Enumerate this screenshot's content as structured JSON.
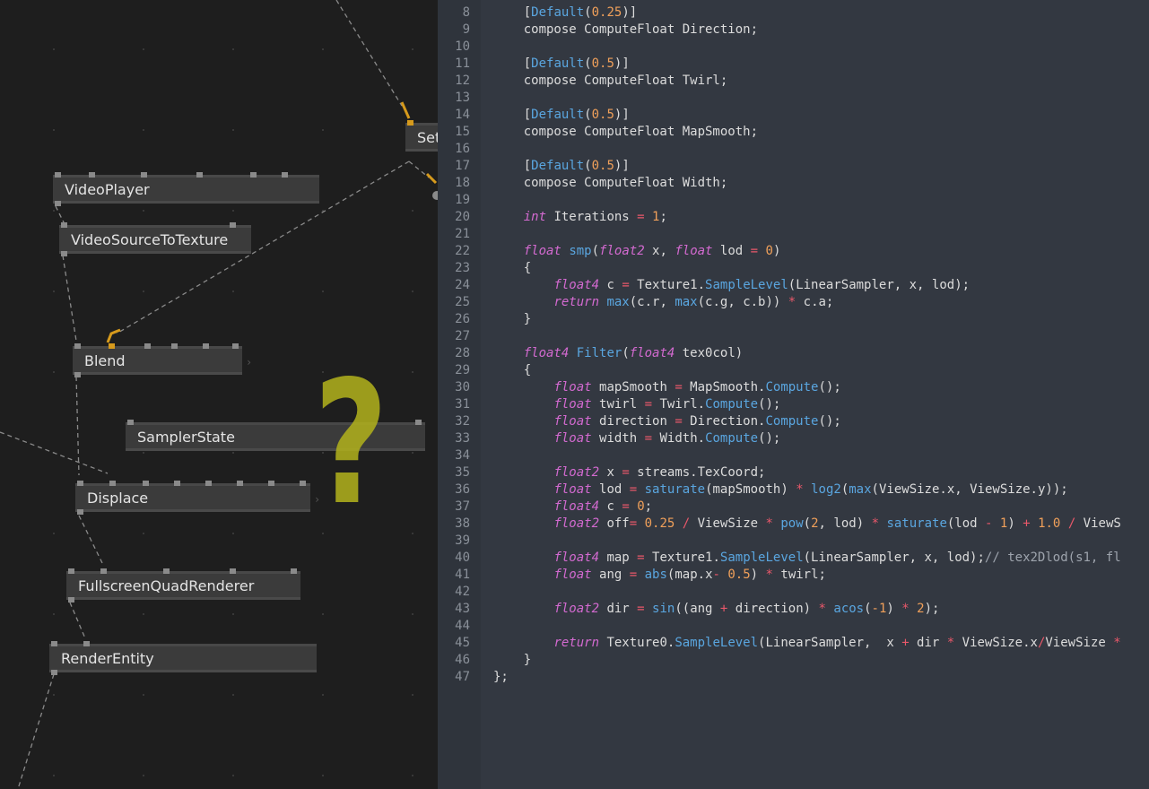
{
  "patch": {
    "nodes": [
      {
        "id": "set",
        "label": "Set"
      },
      {
        "id": "videoplayer",
        "label": "VideoPlayer"
      },
      {
        "id": "videosource",
        "label": "VideoSourceToTexture"
      },
      {
        "id": "blend",
        "label": "Blend"
      },
      {
        "id": "samplerstate",
        "label": "SamplerState"
      },
      {
        "id": "displace",
        "label": "Displace"
      },
      {
        "id": "fsquad",
        "label": "FullscreenQuadRenderer"
      },
      {
        "id": "renderentity",
        "label": "RenderEntity"
      }
    ],
    "annotation": "?",
    "colors": {
      "pin_active": "#d69a1c",
      "annotation": "#b2b21c",
      "node": "#3b3b3b"
    }
  },
  "editor": {
    "colors": {
      "background": "#333841",
      "keyword": "#d36ad0",
      "function": "#5aa6e0",
      "number": "#f0a05a",
      "operator": "#e9586a"
    },
    "lines": [
      {
        "n": "8",
        "tokens": [
          [
            "    [",
            "pl"
          ],
          [
            "Default",
            "fn"
          ],
          [
            "(",
            "pl"
          ],
          [
            "0.25",
            "num"
          ],
          [
            ")]",
            "pl"
          ]
        ]
      },
      {
        "n": "9",
        "tokens": [
          [
            "    compose ComputeFloat Direction;",
            "pl"
          ]
        ]
      },
      {
        "n": "10",
        "tokens": []
      },
      {
        "n": "11",
        "tokens": [
          [
            "    [",
            "pl"
          ],
          [
            "Default",
            "fn"
          ],
          [
            "(",
            "pl"
          ],
          [
            "0.5",
            "num"
          ],
          [
            ")]",
            "pl"
          ]
        ]
      },
      {
        "n": "12",
        "tokens": [
          [
            "    compose ComputeFloat Twirl;",
            "pl"
          ]
        ]
      },
      {
        "n": "13",
        "tokens": []
      },
      {
        "n": "14",
        "tokens": [
          [
            "    [",
            "pl"
          ],
          [
            "Default",
            "fn"
          ],
          [
            "(",
            "pl"
          ],
          [
            "0.5",
            "num"
          ],
          [
            ")]",
            "pl"
          ]
        ]
      },
      {
        "n": "15",
        "tokens": [
          [
            "    compose ComputeFloat MapSmooth;",
            "pl"
          ]
        ]
      },
      {
        "n": "16",
        "tokens": []
      },
      {
        "n": "17",
        "tokens": [
          [
            "    [",
            "pl"
          ],
          [
            "Default",
            "fn"
          ],
          [
            "(",
            "pl"
          ],
          [
            "0.5",
            "num"
          ],
          [
            ")]",
            "pl"
          ]
        ]
      },
      {
        "n": "18",
        "tokens": [
          [
            "    compose ComputeFloat Width;",
            "pl"
          ]
        ]
      },
      {
        "n": "19",
        "tokens": []
      },
      {
        "n": "20",
        "tokens": [
          [
            "    ",
            "pl"
          ],
          [
            "int",
            "kw"
          ],
          [
            " Iterations ",
            "pl"
          ],
          [
            "=",
            "op"
          ],
          [
            " ",
            "pl"
          ],
          [
            "1",
            "num"
          ],
          [
            ";",
            "pl"
          ]
        ]
      },
      {
        "n": "21",
        "tokens": []
      },
      {
        "n": "22",
        "tokens": [
          [
            "    ",
            "pl"
          ],
          [
            "float",
            "kw"
          ],
          [
            " ",
            "pl"
          ],
          [
            "smp",
            "fn"
          ],
          [
            "(",
            "pl"
          ],
          [
            "float2",
            "kw"
          ],
          [
            " x, ",
            "pl"
          ],
          [
            "float",
            "kw"
          ],
          [
            " lod ",
            "pl"
          ],
          [
            "=",
            "op"
          ],
          [
            " ",
            "pl"
          ],
          [
            "0",
            "num"
          ],
          [
            ")",
            "pl"
          ]
        ]
      },
      {
        "n": "23",
        "tokens": [
          [
            "    {",
            "pl"
          ]
        ]
      },
      {
        "n": "24",
        "tokens": [
          [
            "        ",
            "pl"
          ],
          [
            "float4",
            "kw"
          ],
          [
            " c ",
            "pl"
          ],
          [
            "=",
            "op"
          ],
          [
            " Texture1.",
            "pl"
          ],
          [
            "SampleLevel",
            "fn"
          ],
          [
            "(LinearSampler, x, lod);",
            "pl"
          ]
        ]
      },
      {
        "n": "25",
        "tokens": [
          [
            "        ",
            "pl"
          ],
          [
            "return",
            "kw"
          ],
          [
            " ",
            "pl"
          ],
          [
            "max",
            "fn"
          ],
          [
            "(c.r, ",
            "pl"
          ],
          [
            "max",
            "fn"
          ],
          [
            "(c.g, c.b)) ",
            "pl"
          ],
          [
            "*",
            "op"
          ],
          [
            " c.a;",
            "pl"
          ]
        ]
      },
      {
        "n": "26",
        "tokens": [
          [
            "    }",
            "pl"
          ]
        ]
      },
      {
        "n": "27",
        "tokens": []
      },
      {
        "n": "28",
        "tokens": [
          [
            "    ",
            "pl"
          ],
          [
            "float4",
            "kw"
          ],
          [
            " ",
            "pl"
          ],
          [
            "Filter",
            "fn"
          ],
          [
            "(",
            "pl"
          ],
          [
            "float4",
            "kw"
          ],
          [
            " tex0col)",
            "pl"
          ]
        ]
      },
      {
        "n": "29",
        "tokens": [
          [
            "    {",
            "pl"
          ]
        ]
      },
      {
        "n": "30",
        "tokens": [
          [
            "        ",
            "pl"
          ],
          [
            "float",
            "kw"
          ],
          [
            " mapSmooth ",
            "pl"
          ],
          [
            "=",
            "op"
          ],
          [
            " MapSmooth.",
            "pl"
          ],
          [
            "Compute",
            "fn"
          ],
          [
            "();",
            "pl"
          ]
        ]
      },
      {
        "n": "31",
        "tokens": [
          [
            "        ",
            "pl"
          ],
          [
            "float",
            "kw"
          ],
          [
            " twirl ",
            "pl"
          ],
          [
            "=",
            "op"
          ],
          [
            " Twirl.",
            "pl"
          ],
          [
            "Compute",
            "fn"
          ],
          [
            "();",
            "pl"
          ]
        ]
      },
      {
        "n": "32",
        "tokens": [
          [
            "        ",
            "pl"
          ],
          [
            "float",
            "kw"
          ],
          [
            " direction ",
            "pl"
          ],
          [
            "=",
            "op"
          ],
          [
            " Direction.",
            "pl"
          ],
          [
            "Compute",
            "fn"
          ],
          [
            "();",
            "pl"
          ]
        ]
      },
      {
        "n": "33",
        "tokens": [
          [
            "        ",
            "pl"
          ],
          [
            "float",
            "kw"
          ],
          [
            " width ",
            "pl"
          ],
          [
            "=",
            "op"
          ],
          [
            " Width.",
            "pl"
          ],
          [
            "Compute",
            "fn"
          ],
          [
            "();",
            "pl"
          ]
        ]
      },
      {
        "n": "34",
        "tokens": []
      },
      {
        "n": "35",
        "tokens": [
          [
            "        ",
            "pl"
          ],
          [
            "float2",
            "kw"
          ],
          [
            " x ",
            "pl"
          ],
          [
            "=",
            "op"
          ],
          [
            " streams.TexCoord;",
            "pl"
          ]
        ]
      },
      {
        "n": "36",
        "tokens": [
          [
            "        ",
            "pl"
          ],
          [
            "float",
            "kw"
          ],
          [
            " lod ",
            "pl"
          ],
          [
            "=",
            "op"
          ],
          [
            " ",
            "pl"
          ],
          [
            "saturate",
            "fn"
          ],
          [
            "(mapSmooth) ",
            "pl"
          ],
          [
            "*",
            "op"
          ],
          [
            " ",
            "pl"
          ],
          [
            "log2",
            "fn"
          ],
          [
            "(",
            "pl"
          ],
          [
            "max",
            "fn"
          ],
          [
            "(ViewSize.x, ViewSize.y));",
            "pl"
          ]
        ]
      },
      {
        "n": "37",
        "tokens": [
          [
            "        ",
            "pl"
          ],
          [
            "float4",
            "kw"
          ],
          [
            " c ",
            "pl"
          ],
          [
            "=",
            "op"
          ],
          [
            " ",
            "pl"
          ],
          [
            "0",
            "num"
          ],
          [
            ";",
            "pl"
          ]
        ]
      },
      {
        "n": "38",
        "tokens": [
          [
            "        ",
            "pl"
          ],
          [
            "float2",
            "kw"
          ],
          [
            " off",
            "pl"
          ],
          [
            "=",
            "op"
          ],
          [
            " ",
            "pl"
          ],
          [
            "0.25",
            "num"
          ],
          [
            " ",
            "pl"
          ],
          [
            "/",
            "op"
          ],
          [
            " ViewSize ",
            "pl"
          ],
          [
            "*",
            "op"
          ],
          [
            " ",
            "pl"
          ],
          [
            "pow",
            "fn"
          ],
          [
            "(",
            "pl"
          ],
          [
            "2",
            "num"
          ],
          [
            ", lod) ",
            "pl"
          ],
          [
            "*",
            "op"
          ],
          [
            " ",
            "pl"
          ],
          [
            "saturate",
            "fn"
          ],
          [
            "(lod ",
            "pl"
          ],
          [
            "-",
            "op"
          ],
          [
            " ",
            "pl"
          ],
          [
            "1",
            "num"
          ],
          [
            ") ",
            "pl"
          ],
          [
            "+",
            "op"
          ],
          [
            " ",
            "pl"
          ],
          [
            "1.0",
            "num"
          ],
          [
            " ",
            "pl"
          ],
          [
            "/",
            "op"
          ],
          [
            " ViewS",
            "pl"
          ]
        ]
      },
      {
        "n": "39",
        "tokens": []
      },
      {
        "n": "40",
        "tokens": [
          [
            "        ",
            "pl"
          ],
          [
            "float4",
            "kw"
          ],
          [
            " map ",
            "pl"
          ],
          [
            "=",
            "op"
          ],
          [
            " Texture1.",
            "pl"
          ],
          [
            "SampleLevel",
            "fn"
          ],
          [
            "(LinearSampler, x, lod);",
            "pl"
          ],
          [
            "// tex2Dlod(s1, fl",
            "cm"
          ]
        ]
      },
      {
        "n": "41",
        "tokens": [
          [
            "        ",
            "pl"
          ],
          [
            "float",
            "kw"
          ],
          [
            " ang ",
            "pl"
          ],
          [
            "=",
            "op"
          ],
          [
            " ",
            "pl"
          ],
          [
            "abs",
            "fn"
          ],
          [
            "(map.x",
            "pl"
          ],
          [
            "-",
            "op"
          ],
          [
            " ",
            "pl"
          ],
          [
            "0.5",
            "num"
          ],
          [
            ") ",
            "pl"
          ],
          [
            "*",
            "op"
          ],
          [
            " twirl;",
            "pl"
          ]
        ]
      },
      {
        "n": "42",
        "tokens": []
      },
      {
        "n": "43",
        "tokens": [
          [
            "        ",
            "pl"
          ],
          [
            "float2",
            "kw"
          ],
          [
            " dir ",
            "pl"
          ],
          [
            "=",
            "op"
          ],
          [
            " ",
            "pl"
          ],
          [
            "sin",
            "fn"
          ],
          [
            "((ang ",
            "pl"
          ],
          [
            "+",
            "op"
          ],
          [
            " direction) ",
            "pl"
          ],
          [
            "*",
            "op"
          ],
          [
            " ",
            "pl"
          ],
          [
            "acos",
            "fn"
          ],
          [
            "(",
            "pl"
          ],
          [
            "-1",
            "num"
          ],
          [
            ") ",
            "pl"
          ],
          [
            "*",
            "op"
          ],
          [
            " ",
            "pl"
          ],
          [
            "2",
            "num"
          ],
          [
            ");",
            "pl"
          ]
        ]
      },
      {
        "n": "44",
        "tokens": []
      },
      {
        "n": "45",
        "tokens": [
          [
            "        ",
            "pl"
          ],
          [
            "return",
            "kw"
          ],
          [
            " Texture0.",
            "pl"
          ],
          [
            "SampleLevel",
            "fn"
          ],
          [
            "(LinearSampler,  x ",
            "pl"
          ],
          [
            "+",
            "op"
          ],
          [
            " dir ",
            "pl"
          ],
          [
            "*",
            "op"
          ],
          [
            " ViewSize.x",
            "pl"
          ],
          [
            "/",
            "op"
          ],
          [
            "ViewSize ",
            "pl"
          ],
          [
            "*",
            "op"
          ]
        ]
      },
      {
        "n": "46",
        "tokens": [
          [
            "    }",
            "pl"
          ]
        ]
      },
      {
        "n": "47",
        "tokens": [
          [
            "};",
            "pl"
          ]
        ]
      }
    ]
  }
}
